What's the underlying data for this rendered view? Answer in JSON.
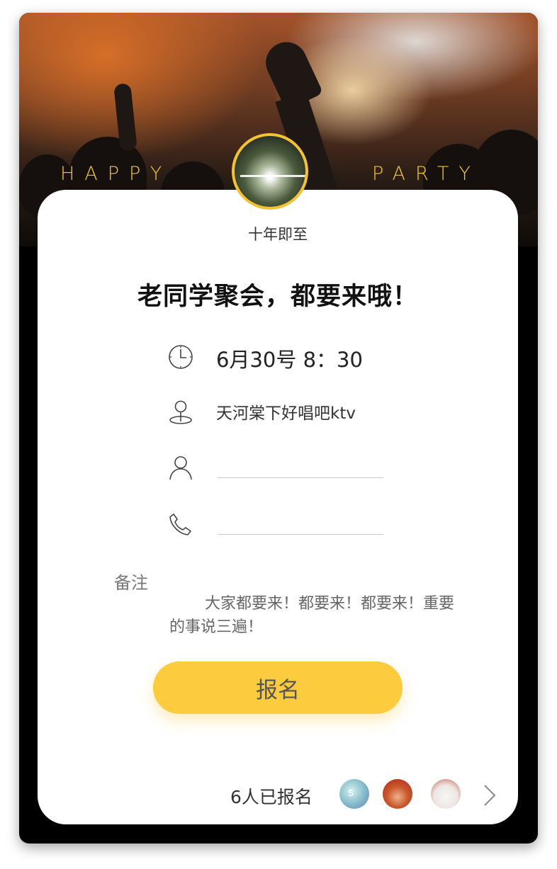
{
  "hero": {
    "word_left": "HAPPY",
    "word_right": "PARTY"
  },
  "event": {
    "organizer": "十年即至",
    "title": "老同学聚会，都要来哦！",
    "datetime": "6月30号 8：30",
    "location": "天河棠下好唱吧ktv"
  },
  "form": {
    "name_value": "",
    "phone_value": "",
    "note_label": "备注",
    "note_text": "大家都要来！都要来！都要来！重要的事说三遍！"
  },
  "signup_label": "报名",
  "attendees": {
    "count_text": "6人已报名",
    "avatar_1_text": "s"
  },
  "colors": {
    "accent": "#fccb3e",
    "avatar_border": "#f5c235",
    "hero_text": "#f2c233"
  },
  "icons": [
    "clock-icon",
    "location-pin-icon",
    "user-icon",
    "phone-icon",
    "chevron-right-icon"
  ]
}
